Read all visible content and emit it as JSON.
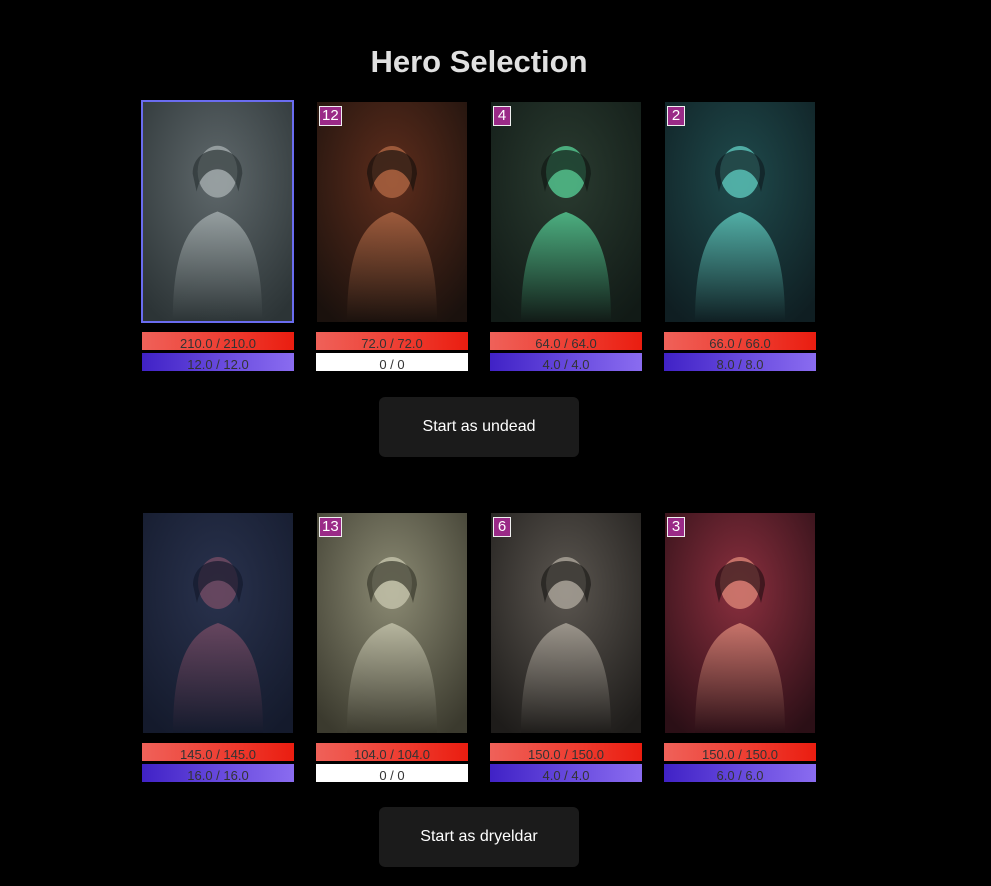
{
  "title": "Hero Selection",
  "factions": [
    {
      "button_label": "Start as undead",
      "heroes": [
        {
          "level": "",
          "hp": "210.0 / 210.0",
          "mp": "12.0 / 12.0",
          "selected": true,
          "palette": [
            "#2c3436",
            "#5f686b",
            "#a9b2b3"
          ]
        },
        {
          "level": "12",
          "hp": "72.0 / 72.0",
          "mp": "0 / 0",
          "selected": false,
          "palette": [
            "#1a110d",
            "#5e2d1c",
            "#b46a46"
          ]
        },
        {
          "level": "4",
          "hp": "64.0 / 64.0",
          "mp": "4.0 / 4.0",
          "selected": false,
          "palette": [
            "#111a16",
            "#2a3b30",
            "#58d49a"
          ]
        },
        {
          "level": "2",
          "hp": "66.0 / 66.0",
          "mp": "8.0 / 8.0",
          "selected": false,
          "palette": [
            "#0f1e22",
            "#1f4a4c",
            "#62d0c4"
          ]
        }
      ]
    },
    {
      "button_label": "Start as dryeldar",
      "heroes": [
        {
          "level": "",
          "hp": "145.0 / 145.0",
          "mp": "16.0 / 16.0",
          "selected": false,
          "palette": [
            "#141a2c",
            "#29324d",
            "#7a4d66"
          ]
        },
        {
          "level": "13",
          "hp": "104.0 / 104.0",
          "mp": "0 / 0",
          "selected": false,
          "palette": [
            "#3b3a2e",
            "#8b8a73",
            "#c9c8b0"
          ]
        },
        {
          "level": "6",
          "hp": "150.0 / 150.0",
          "mp": "4.0 / 4.0",
          "selected": false,
          "palette": [
            "#1e1c1a",
            "#5b5650",
            "#b2aba0"
          ]
        },
        {
          "level": "3",
          "hp": "150.0 / 150.0",
          "mp": "6.0 / 6.0",
          "selected": false,
          "palette": [
            "#2b0f16",
            "#8a2f3e",
            "#e08a7a"
          ]
        }
      ]
    }
  ]
}
